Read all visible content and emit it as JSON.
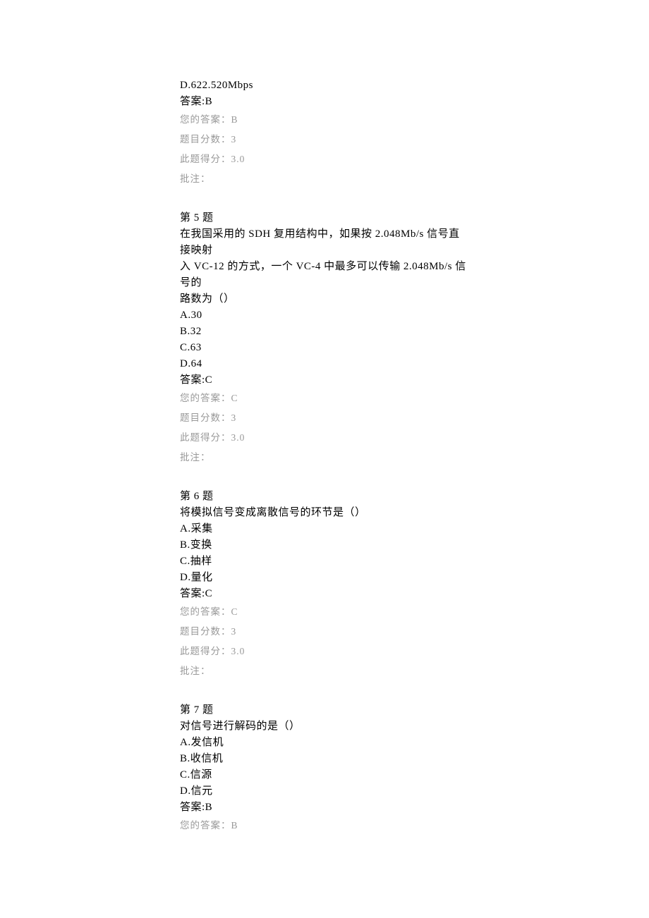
{
  "q4_tail": {
    "option_d": "D.622.520Mbps",
    "answer_line": "答案:B",
    "your_answer": "您的答案：B",
    "score_label": "题目分数：3",
    "got_score": "此题得分：3.0",
    "remark": "批注："
  },
  "q5": {
    "header": "第 5 题",
    "stem_l1": "在我国采用的 SDH 复用结构中，如果按 2.048Mb/s 信号直接映射",
    "stem_l2": "入 VC-12 的方式，一个 VC-4 中最多可以传输 2.048Mb/s 信号的",
    "stem_l3": "路数为（）",
    "option_a": "A.30",
    "option_b": "B.32",
    "option_c": "C.63",
    "option_d": "D.64",
    "answer_line": "答案:C",
    "your_answer": "您的答案：C",
    "score_label": "题目分数：3",
    "got_score": "此题得分：3.0",
    "remark": "批注："
  },
  "q6": {
    "header": "第 6 题",
    "stem": "将模拟信号变成离散信号的环节是（）",
    "option_a": "A.采集",
    "option_b": "B.变换",
    "option_c": "C.抽样",
    "option_d": "D.量化",
    "answer_line": "答案:C",
    "your_answer": "您的答案：C",
    "score_label": "题目分数：3",
    "got_score": "此题得分：3.0",
    "remark": "批注："
  },
  "q7": {
    "header": "第 7 题",
    "stem": "对信号进行解码的是（）",
    "option_a": "A.发信机",
    "option_b": "B.收信机",
    "option_c": "C.信源",
    "option_d": "D.信元",
    "answer_line": "答案:B",
    "your_answer": "您的答案：B"
  }
}
